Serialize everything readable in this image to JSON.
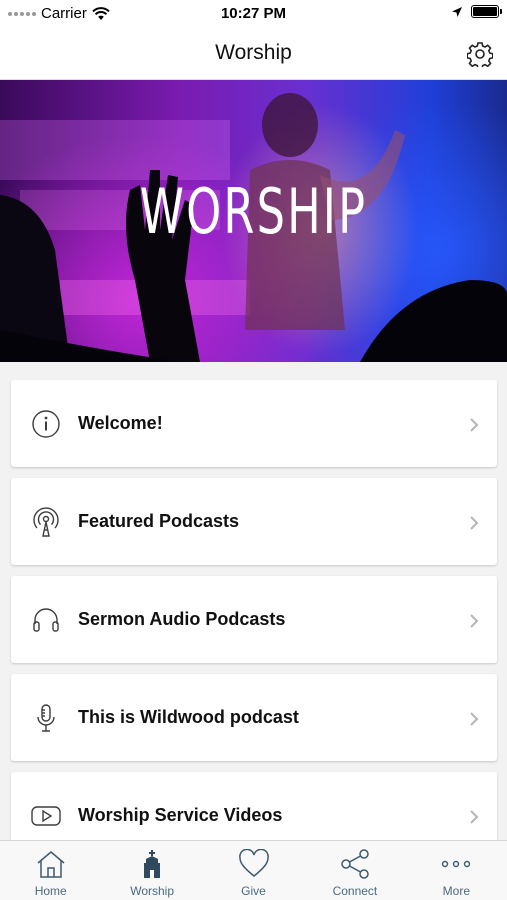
{
  "status_bar": {
    "carrier": "Carrier",
    "time": "10:27 PM"
  },
  "nav": {
    "title": "Worship",
    "settings_icon": "gear-icon"
  },
  "hero": {
    "title": "WORSHIP"
  },
  "menu": {
    "items": [
      {
        "label": "Welcome!",
        "icon": "info-icon"
      },
      {
        "label": "Featured Podcasts",
        "icon": "podcast-icon"
      },
      {
        "label": "Sermon Audio Podcasts",
        "icon": "headphones-icon"
      },
      {
        "label": "This is Wildwood podcast",
        "icon": "microphone-icon"
      },
      {
        "label": "Worship Service Videos",
        "icon": "play-video-icon"
      }
    ]
  },
  "tabs": [
    {
      "label": "Home",
      "icon": "home-icon"
    },
    {
      "label": "Worship",
      "icon": "church-icon",
      "active": true
    },
    {
      "label": "Give",
      "icon": "heart-icon"
    },
    {
      "label": "Connect",
      "icon": "share-icon"
    },
    {
      "label": "More",
      "icon": "more-dots-icon"
    }
  ],
  "colors": {
    "tab_label": "#4a6a80",
    "icon_stroke": "#3d5a6e",
    "hero_purple": "#7a1bb0",
    "hero_blue": "#1f3fd8"
  }
}
